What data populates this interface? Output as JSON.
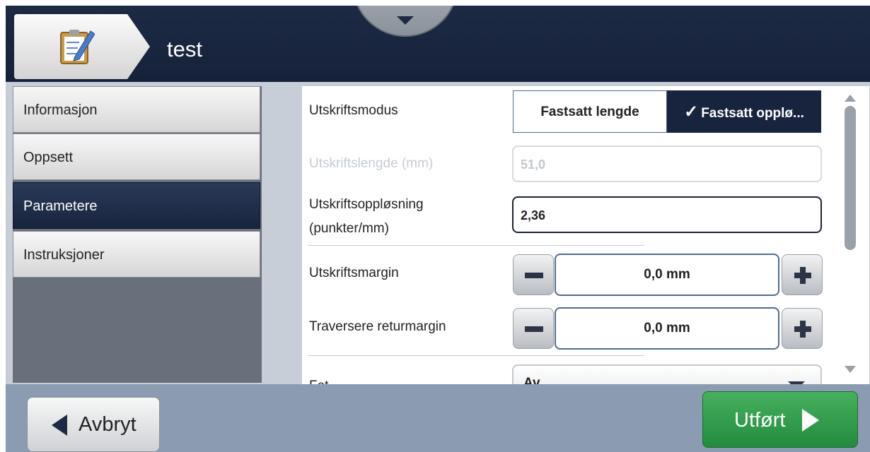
{
  "header": {
    "icon": "clipboard-edit-icon",
    "title": "test",
    "drop_handle_icon": "chevron-down-icon"
  },
  "sidebar": {
    "items": [
      {
        "label": "Informasjon",
        "active": false
      },
      {
        "label": "Oppsett",
        "active": false
      },
      {
        "label": "Parametere",
        "active": true
      },
      {
        "label": "Instruksjoner",
        "active": false
      }
    ]
  },
  "form": {
    "print_mode": {
      "label": "Utskriftsmodus",
      "options": [
        "Fastsatt lengde",
        "Fastsatt opplø..."
      ],
      "selected": "Fastsatt opplø..."
    },
    "print_length": {
      "label": "Utskriftslengde (mm)",
      "value": "51,0",
      "disabled": true
    },
    "print_resolution": {
      "label_line1": "Utskriftsoppløsning",
      "label_line2": "(punkter/mm)",
      "value": "2,36"
    },
    "print_margin": {
      "label": "Utskriftsmargin",
      "value": "0,0 mm"
    },
    "reverse_margin": {
      "label": "Traversere returmargin",
      "value": "0,0 mm"
    },
    "bold": {
      "label": "Fet",
      "value": "Av"
    }
  },
  "footer": {
    "cancel_label": "Avbryt",
    "done_label": "Utført"
  },
  "colors": {
    "header_bg": "#1d2a44",
    "active_tab": "#18243d",
    "done_green": "#2e9a48",
    "footer_bg": "#8b9bb1"
  }
}
